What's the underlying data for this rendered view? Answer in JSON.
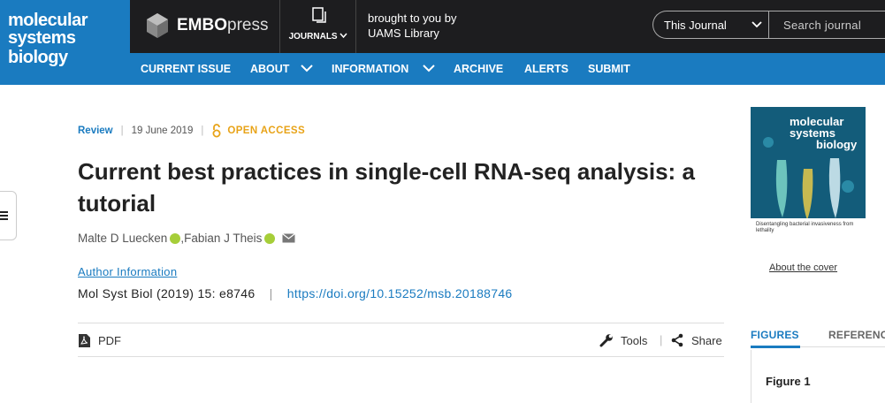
{
  "logo": {
    "lines": [
      "molecular",
      "systems",
      "biology"
    ]
  },
  "publisher": {
    "name_bold": "EMBO",
    "name_light": "press"
  },
  "journals_menu": {
    "label": "JOURNALS"
  },
  "access": {
    "line1": "brought to you by",
    "line2": "UAMS Library"
  },
  "search": {
    "scope": "This Journal",
    "placeholder": "Search journal"
  },
  "nav": {
    "items": [
      "CURRENT ISSUE",
      "ABOUT",
      "INFORMATION",
      "ARCHIVE",
      "ALERTS",
      "SUBMIT"
    ]
  },
  "article": {
    "type": "Review",
    "date": "19 June 2019",
    "open_access": "OPEN ACCESS",
    "title": "Current best practices in single-cell RNA-seq analysis: a tutorial",
    "authors": [
      "Malte D Luecken",
      "Fabian J Theis"
    ],
    "author_sep": ",",
    "author_info": "Author Information",
    "citation": "Mol Syst Biol (2019) 15: e8746",
    "doi": "https://doi.org/10.15252/msb.20188746"
  },
  "toolbar": {
    "pdf": "PDF",
    "tools": "Tools",
    "share": "Share"
  },
  "cover": {
    "title_lines": [
      "molecular",
      "systems",
      "biology"
    ],
    "caption": "Disentangling bacterial invasiveness from lethality",
    "link": "About the cover"
  },
  "right_tabs": {
    "figures": "FIGURES",
    "references": "REFERENCES"
  },
  "figure": {
    "label": "Figure 1"
  },
  "colors": {
    "brand_blue": "#1a7bc0",
    "header_dark": "#1d1d1f",
    "open_access": "#e8a317",
    "orcid_green": "#a6ce39"
  }
}
